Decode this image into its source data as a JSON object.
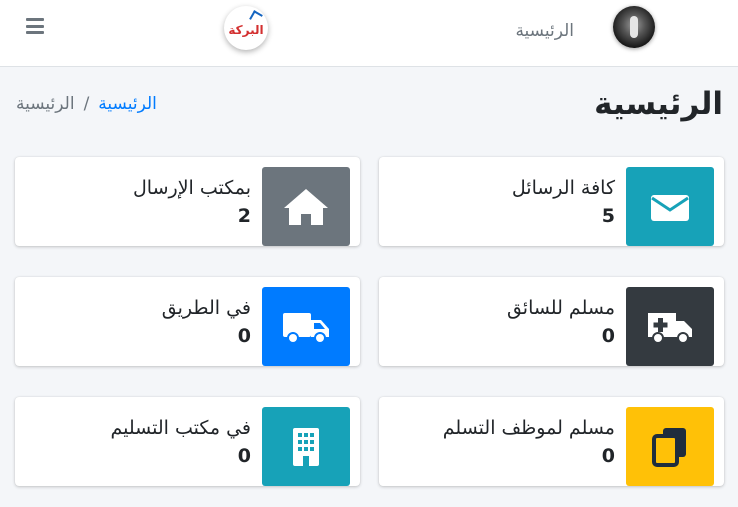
{
  "header": {
    "logo_text": "البركة",
    "nav_home": "الرئيسية"
  },
  "page": {
    "title": "الرئيسية",
    "breadcrumb": {
      "home": "الرئيسية",
      "current": "الرئيسية",
      "separator": "/"
    }
  },
  "cards": [
    {
      "label": "كافة الرسائل",
      "count": "5",
      "icon": "envelope-icon",
      "color": "#17a2b8"
    },
    {
      "label": "بمكتب الإرسال",
      "count": "2",
      "icon": "home-icon",
      "color": "#6c757d"
    },
    {
      "label": "مسلم للسائق",
      "count": "0",
      "icon": "ambulance-icon",
      "color": "#343a40"
    },
    {
      "label": "في الطريق",
      "count": "0",
      "icon": "truck-icon",
      "color": "#007bff"
    },
    {
      "label": "مسلم لموظف التسلم",
      "count": "0",
      "icon": "copy-icon",
      "color": "#ffc107"
    },
    {
      "label": "في مكتب التسليم",
      "count": "0",
      "icon": "building-icon",
      "color": "#17a2b8"
    }
  ]
}
